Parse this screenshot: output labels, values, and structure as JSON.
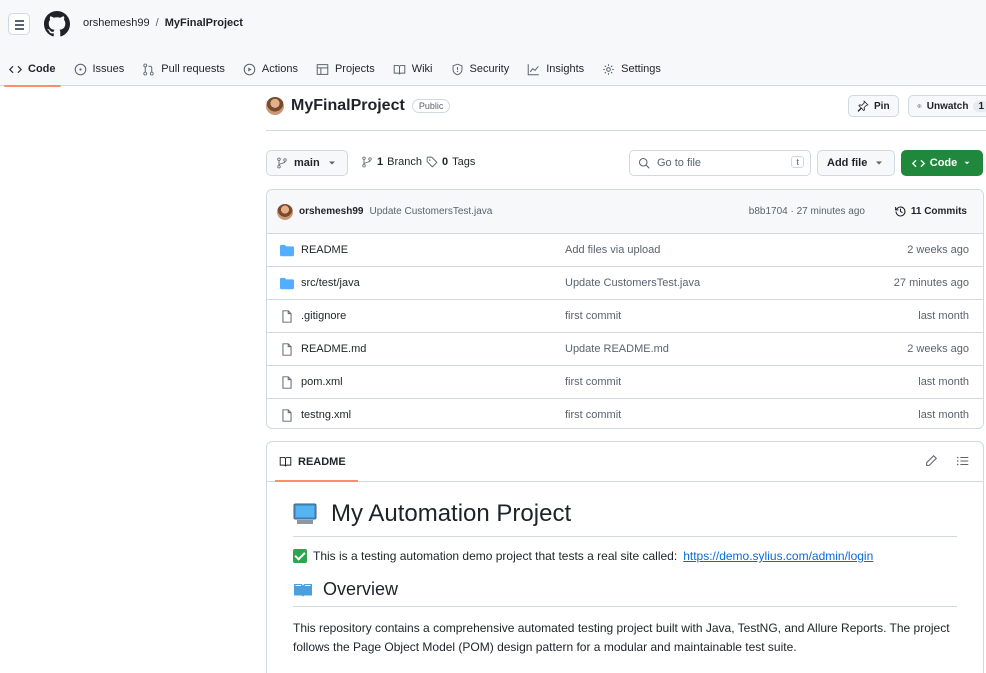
{
  "header": {
    "owner": "orshemesh99",
    "separator": "/",
    "repo": "MyFinalProject"
  },
  "tabs": [
    {
      "label": "Code",
      "icon": "code-icon"
    },
    {
      "label": "Issues",
      "icon": "issue-icon"
    },
    {
      "label": "Pull requests",
      "icon": "pull-request-icon"
    },
    {
      "label": "Actions",
      "icon": "play-icon"
    },
    {
      "label": "Projects",
      "icon": "table-icon"
    },
    {
      "label": "Wiki",
      "icon": "book-icon"
    },
    {
      "label": "Security",
      "icon": "shield-icon"
    },
    {
      "label": "Insights",
      "icon": "graph-icon"
    },
    {
      "label": "Settings",
      "icon": "gear-icon"
    }
  ],
  "repo_header": {
    "name": "MyFinalProject",
    "visibility": "Public",
    "pin_label": "Pin",
    "unwatch_label": "Unwatch",
    "unwatch_count": "1"
  },
  "branch_bar": {
    "branch": "main",
    "branches_count": "1",
    "branches_label": "Branch",
    "tags_count": "0",
    "tags_label": "Tags",
    "goto_placeholder": "Go to file",
    "goto_shortcut": "t",
    "add_file_label": "Add file",
    "code_label": "Code"
  },
  "latest_commit": {
    "user": "orshemesh99",
    "message": "Update CustomersTest.java",
    "meta": "b8b1704 · 27 minutes ago",
    "commits_label": "11 Commits"
  },
  "files": [
    {
      "name": "README",
      "type": "folder",
      "message": "Add files via upload",
      "date": "2 weeks ago"
    },
    {
      "name": "src/test/java",
      "type": "folder",
      "message": "Update CustomersTest.java",
      "date": "27 minutes ago"
    },
    {
      "name": ".gitignore",
      "type": "file",
      "message": "first commit",
      "date": "last month"
    },
    {
      "name": "README.md",
      "type": "file",
      "message": "Update README.md",
      "date": "2 weeks ago"
    },
    {
      "name": "pom.xml",
      "type": "file",
      "message": "first commit",
      "date": "last month"
    },
    {
      "name": "testng.xml",
      "type": "file",
      "message": "first commit",
      "date": "last month"
    }
  ],
  "readme": {
    "tab_label": "README",
    "title": "My Automation Project",
    "intro": "This is a testing automation demo project that tests a real site called:",
    "intro_link": "https://demo.sylius.com/admin/login",
    "overview_heading": "Overview",
    "overview_text": "This repository contains a comprehensive automated testing project built with Java, TestNG, and Allure Reports. The project follows the Page Object Model (POM) design pattern for a modular and maintainable test suite."
  },
  "colors": {
    "accent_underline": "#fd8c73",
    "primary_button": "#1f883d",
    "folder": "#54aeff",
    "link": "#0969da"
  }
}
